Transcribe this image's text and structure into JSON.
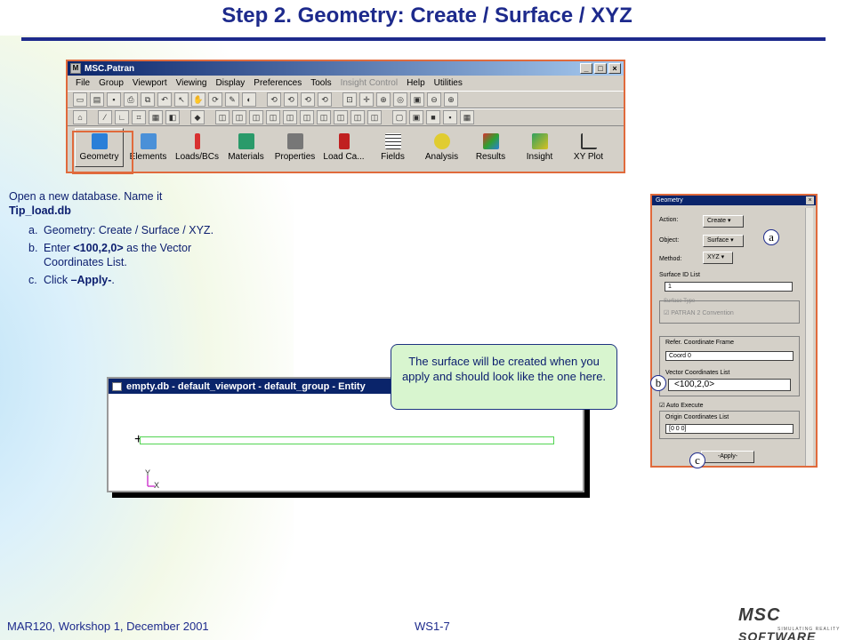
{
  "slide": {
    "title": "Step 2. Geometry: Create / Surface / XYZ",
    "footer_left": "MAR120, Workshop 1,  December 2001",
    "footer_mid": "WS1-7"
  },
  "patran": {
    "window_title": "MSC.Patran",
    "menu": [
      "File",
      "Group",
      "Viewport",
      "Viewing",
      "Display",
      "Preferences",
      "Tools",
      "Insight Control",
      "Help",
      "Utilities"
    ],
    "apps": [
      {
        "label": "Geometry",
        "icon": "cube-icon",
        "color": "#2a7fd8"
      },
      {
        "label": "Elements",
        "icon": "mesh-cube-icon",
        "color": "#4a90d8"
      },
      {
        "label": "Loads/BCs",
        "icon": "arrow-down-icon",
        "color": "#d83030"
      },
      {
        "label": "Materials",
        "icon": "materials-icon",
        "color": "#2a9a6a"
      },
      {
        "label": "Properties",
        "icon": "properties-icon",
        "color": "#555555"
      },
      {
        "label": "Load Ca...",
        "icon": "load-cases-icon",
        "color": "#c02020"
      },
      {
        "label": "Fields",
        "icon": "grid-icon",
        "color": "#333333"
      },
      {
        "label": "Analysis",
        "icon": "bulb-icon",
        "color": "#d8c020"
      },
      {
        "label": "Results",
        "icon": "results-cube-icon",
        "color": "#30a030"
      },
      {
        "label": "Insight",
        "icon": "insight-cube-icon",
        "color": "#30a060"
      },
      {
        "label": "XY Plot",
        "icon": "xy-plot-icon",
        "color": "#333333"
      }
    ]
  },
  "instructions": {
    "intro_line1": "Open a new database.  Name it",
    "intro_line2": "Tip_load.db",
    "steps": [
      {
        "letter": "a.",
        "text": "Geometry: Create / Surface / XYZ."
      },
      {
        "letter": "b.",
        "text_pre": "Enter ",
        "text_bold": "<100,2,0>",
        "text_post": " as the Vector Coordinates List."
      },
      {
        "letter": "c.",
        "text_pre": "Click ",
        "text_bold": "–Apply-",
        "text_post": "."
      }
    ]
  },
  "viewport": {
    "title": "empty.db - default_viewport - default_group - Entity",
    "axis_y": "Y",
    "axis_x": "X"
  },
  "callout": "The surface will be created when you apply and should look like the one here.",
  "geometry_form": {
    "title": "Geometry",
    "action_label": "Action:",
    "action_value": "Create",
    "object_label": "Object:",
    "object_value": "Surface",
    "method_label": "Method:",
    "method_value": "XYZ",
    "surface_id_label": "Surface ID List",
    "surface_id_value": "1",
    "surface_type_label": "Surface Type",
    "patran_convention": "PATRAN 2 Convention",
    "refer_frame_label": "Refer. Coordinate Frame",
    "refer_frame_value": "Coord 0",
    "vector_label": "Vector Coordinates List",
    "vector_value": "<100,2,0>",
    "auto_execute": "Auto Execute",
    "origin_label": "Origin Coordinates List",
    "origin_value": "[0 0 0]",
    "apply": "-Apply-"
  },
  "markers": {
    "a": "a",
    "b": "b",
    "c": "c"
  },
  "logo": {
    "word": "MSC",
    "word2": "SOFTWARE",
    "tagline": "SIMULATING REALITY"
  }
}
